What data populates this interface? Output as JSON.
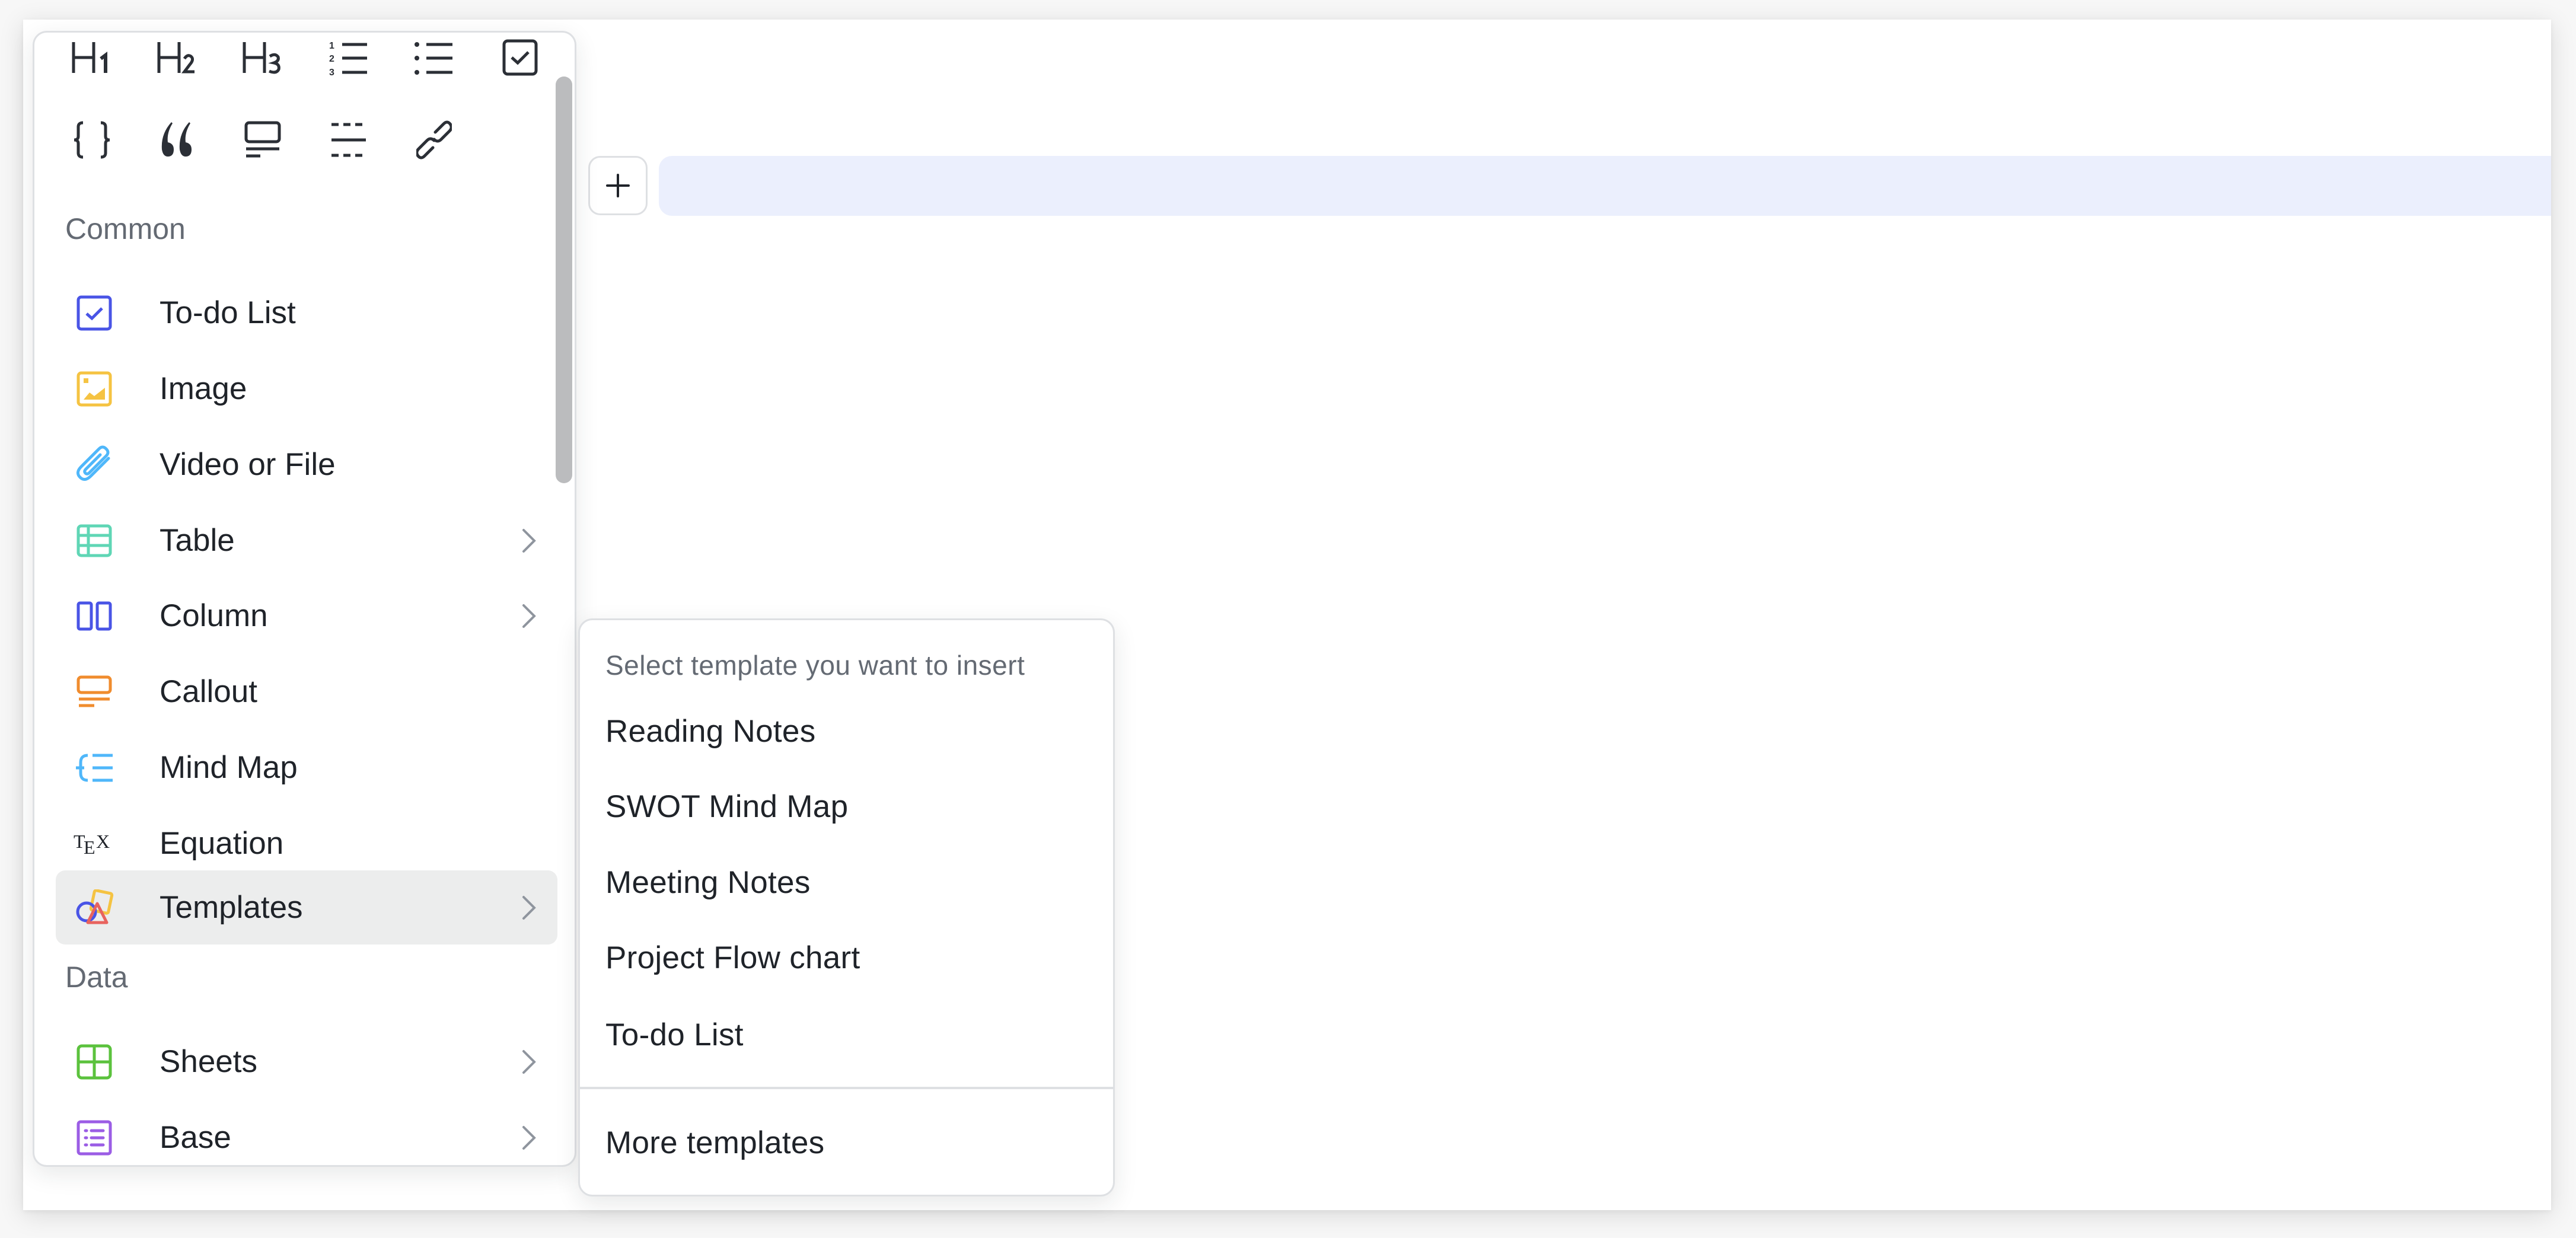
{
  "editor": {
    "add_block_icon": "plus-icon"
  },
  "menu": {
    "toolbar_row1": [
      {
        "name": "heading-1",
        "icon": "heading-1-icon"
      },
      {
        "name": "heading-2",
        "icon": "heading-2-icon"
      },
      {
        "name": "heading-3",
        "icon": "heading-3-icon"
      },
      {
        "name": "ordered-list",
        "icon": "ordered-list-icon"
      },
      {
        "name": "bullet-list",
        "icon": "bullet-list-icon"
      },
      {
        "name": "task-list",
        "icon": "checkbox-icon"
      }
    ],
    "toolbar_row2": [
      {
        "name": "code-block",
        "icon": "code-braces-icon"
      },
      {
        "name": "quote",
        "icon": "quote-icon"
      },
      {
        "name": "callout",
        "icon": "callout-icon"
      },
      {
        "name": "divider",
        "icon": "divider-icon"
      },
      {
        "name": "link",
        "icon": "link-icon"
      }
    ],
    "sections": [
      {
        "label": "Common",
        "items": [
          {
            "label": "To-do List",
            "icon": "todo-checkbox-icon",
            "color": "#4954e6",
            "submenu": false
          },
          {
            "label": "Image",
            "icon": "image-icon",
            "color": "#f5c342",
            "submenu": false
          },
          {
            "label": "Video or File",
            "icon": "paperclip-icon",
            "color": "#4fb7fa",
            "submenu": false
          },
          {
            "label": "Table",
            "icon": "table-icon",
            "color": "#5fd6b5",
            "submenu": true
          },
          {
            "label": "Column",
            "icon": "column-icon",
            "color": "#4954e6",
            "submenu": true
          },
          {
            "label": "Callout",
            "icon": "callout-icon",
            "color": "#f08c2e",
            "submenu": false
          },
          {
            "label": "Mind Map",
            "icon": "mind-map-icon",
            "color": "#4fb7fa",
            "submenu": false
          },
          {
            "label": "Equation",
            "icon": "tex-icon",
            "color": "#1f2329",
            "submenu": false
          },
          {
            "label": "Templates",
            "icon": "templates-shapes-icon",
            "color": "#e8635e",
            "submenu": true,
            "active": true
          }
        ]
      },
      {
        "label": "Data",
        "items": [
          {
            "label": "Sheets",
            "icon": "sheets-icon",
            "color": "#5bc23d",
            "submenu": true
          },
          {
            "label": "Base",
            "icon": "base-icon",
            "color": "#9b5de5",
            "submenu": true
          }
        ]
      }
    ]
  },
  "templates_submenu": {
    "title": "Select template you want to insert",
    "items": [
      "Reading Notes",
      "SWOT Mind Map",
      "Meeting Notes",
      "Project Flow chart",
      "To-do List"
    ],
    "more_label": "More templates"
  },
  "colors": {
    "text": "#1f2329",
    "secondary_text": "#646a73",
    "active_row": "#eceded",
    "block_highlight": "#ebeffd",
    "border": "#dee0e3",
    "chevron": "#8f959e"
  }
}
